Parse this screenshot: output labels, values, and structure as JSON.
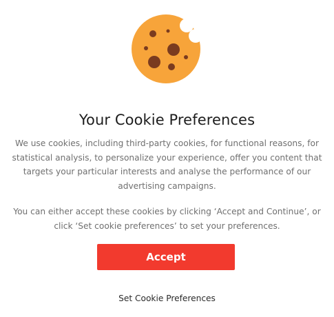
{
  "dialog": {
    "icon": "cookie-icon",
    "title": "Your Cookie Preferences",
    "paragraph1": [
      "We use cookies, including third-party cookies, for functional reasons, for",
      "statistical analysis, to personalize your experience, offer you content that",
      "targets your particular interests and analyse the performance of our",
      "advertising campaigns."
    ],
    "paragraph2": [
      "You can either accept these cookies by clicking ‘Accept and Continue’, or",
      "click ‘Set cookie preferences’ to set your preferences."
    ],
    "accept_label": "Accept",
    "preferences_label": "Set Cookie Preferences"
  },
  "colors": {
    "accent": "#f23a2e",
    "cookie_body": "#f7a43a",
    "cookie_chip": "#7a3b1f",
    "text_muted": "#6f6f6f"
  }
}
